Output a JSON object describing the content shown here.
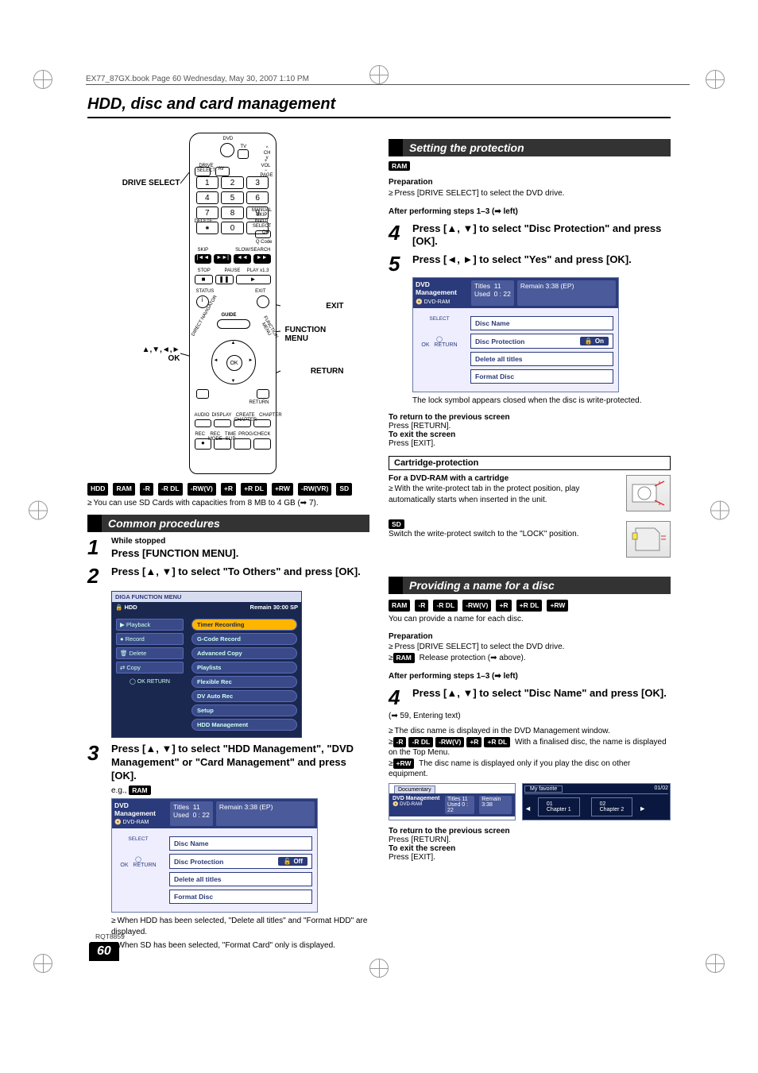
{
  "header_line": "EX77_87GX.book  Page 60  Wednesday, May 30, 2007  1:10 PM",
  "title": "HDD, disc and card management",
  "doc_code": "RQT8859",
  "page_number": "60",
  "remote": {
    "label_drive_select": "DRIVE SELECT",
    "label_exit": "EXIT",
    "label_function_menu": "FUNCTION MENU",
    "label_return": "RETURN",
    "label_nav_ok": "▲,▼,◄,►\nOK",
    "top_dvd": "DVD",
    "top_tv": "TV",
    "ch": "CH",
    "vol": "VOL",
    "drive_select_btn": "DRIVE SELECT",
    "av": "AV",
    "page": "PAGE",
    "numbers": [
      "1",
      "2",
      "3",
      "4",
      "5",
      "6",
      "7",
      "8",
      "9",
      "0"
    ],
    "delete": "DELETE",
    "input_select": "INPUT SELECT",
    "manual_skip": "MANUAL SKIP",
    "ok_btn": "OK",
    "q_code": "Q Code",
    "skip": "SKIP",
    "slow_search": "SLOW/SEARCH",
    "stop": "STOP",
    "pause": "PAUSE",
    "play": "PLAY x1.3",
    "status": "STATUS",
    "exit": "EXIT",
    "guide": "GUIDE",
    "direct_nav": "DIRECT NAVIGATOR",
    "function_menu": "FUNCTION MENU",
    "ok": "OK",
    "return": "RETURN",
    "audio": "AUDIO",
    "display": "DISPLAY",
    "create_chapter": "CREATE CHAPTER",
    "chapter": "CHAPTER",
    "rec": "REC",
    "rec_mode": "REC MODE",
    "time_slip": "TIME SLIP",
    "prog_check": "PROG/CHECK"
  },
  "formats_row1": [
    "HDD",
    "RAM",
    "-R",
    "-R DL",
    "-RW(V)",
    "+R",
    "+R DL",
    "+RW",
    "-RW(VR)",
    "SD"
  ],
  "sd_note": "You can use SD Cards with capacities from 8 MB to 4 GB (➡ 7).",
  "sections": {
    "common": "Common procedures",
    "setting_protection": "Setting the protection",
    "providing_name": "Providing a name for a disc"
  },
  "step1": {
    "sub": "While stopped",
    "title": "Press [FUNCTION MENU]."
  },
  "step2": {
    "title": "Press [▲, ▼] to select \"To Others\" and press [OK]."
  },
  "func_menu": {
    "brand": "DIGA  FUNCTION MENU",
    "hdd": "HDD",
    "remain": "Remain  30:00 SP",
    "left": [
      "Playback",
      "Record",
      "Delete",
      "Copy"
    ],
    "right_top": "Timer Recording",
    "right": [
      "G-Code Record",
      "Advanced Copy",
      "Playlists",
      "Flexible Rec",
      "DV Auto Rec",
      "Setup",
      "HDD Management"
    ],
    "nav": "OK  RETURN"
  },
  "step3": {
    "title": "Press [▲, ▼] to select \"HDD Management\", \"DVD Management\" or \"Card Management\" and press [OK].",
    "eg_prefix": "e.g.,",
    "eg_badge": "RAM"
  },
  "mgmt": {
    "header_title": "DVD Management",
    "header_icon": "DVD-RAM",
    "titles_label": "Titles",
    "titles_val": "11",
    "used_label": "Used",
    "used_val": "0 : 22",
    "remain": "Remain  3:38 (EP)",
    "rows": {
      "disc_name": "Disc Name",
      "disc_protection": "Disc Protection",
      "off": "Off",
      "on": "On",
      "delete_all": "Delete all titles",
      "format_disc": "Format Disc"
    },
    "side_select": "SELECT",
    "side_ok": "OK",
    "side_return": "RETURN"
  },
  "step3_notes": [
    "When HDD has been selected, \"Delete all titles\" and \"Format HDD\" are displayed.",
    "When SD has been selected, \"Format Card\" only is displayed."
  ],
  "protection": {
    "badge": "RAM",
    "prep_h": "Preparation",
    "prep": "Press [DRIVE SELECT] to select the DVD drive.",
    "after": "After performing steps 1–3 (➡ left)",
    "step4": "Press [▲, ▼] to select \"Disc Protection\" and press [OK].",
    "step5": "Press [◄, ►] to select \"Yes\" and press [OK].",
    "lock_note": "The lock symbol appears closed when the disc is write-protected.",
    "return_h": "To return to the previous screen",
    "return_t": "Press [RETURN].",
    "exit_h": "To exit the screen",
    "exit_t": "Press [EXIT].",
    "cartridge_h": "Cartridge-protection",
    "cart_h": "For a DVD-RAM with a cartridge",
    "cart_t": "With the write-protect tab in the protect position, play automatically starts when inserted in the unit.",
    "sd_badge": "SD",
    "sd_t": "Switch the write-protect switch to the \"LOCK\" position."
  },
  "naming": {
    "badges": [
      "RAM",
      "-R",
      "-R DL",
      "-RW(V)",
      "+R",
      "+R DL",
      "+RW"
    ],
    "intro": "You can provide a name for each disc.",
    "prep_h": "Preparation",
    "prep1": "Press [DRIVE SELECT] to select the DVD drive.",
    "prep2_badge": "RAM",
    "prep2": "Release protection (➡ above).",
    "after": "After performing steps 1–3 (➡ left)",
    "step4": "Press [▲, ▼] to select \"Disc Name\" and press [OK].",
    "entering": "(➡ 59, Entering text)",
    "bul1": "The disc name is displayed in the DVD Management window.",
    "bul2_badges": [
      "-R",
      "-R DL",
      "-RW(V)",
      "+R",
      "+R DL"
    ],
    "bul2": "With a finalised disc, the name is displayed on the Top Menu.",
    "bul3_badge": "+RW",
    "bul3": "The disc name is displayed only if you play the disc on other equipment.",
    "topmenu": {
      "tab": "Documentary",
      "left_title": "DVD Management",
      "left_line": "DVD-RAM",
      "titles": "Titles",
      "titles_v": "11",
      "used": "Used",
      "used_v": "0 : 22",
      "remain": "Remain  3:38",
      "right_title": "My favorite",
      "page": "01/02",
      "ch1": "01\nChapter 1",
      "ch2": "02\nChapter 2"
    },
    "return_h": "To return to the previous screen",
    "return_t": "Press [RETURN].",
    "exit_h": "To exit the screen",
    "exit_t": "Press [EXIT]."
  }
}
